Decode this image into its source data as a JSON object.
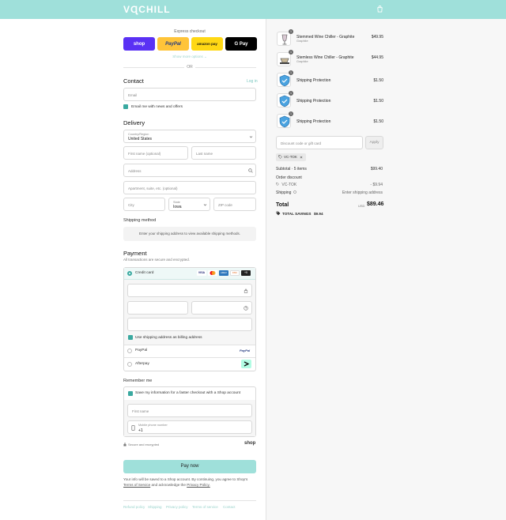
{
  "header": {
    "logo": "VɊCHILL"
  },
  "express": {
    "title": "Express checkout",
    "buttons": [
      "shop",
      "PayPal",
      "amazon pay",
      "G Pay"
    ],
    "show_more": "Show more options ⌄",
    "or": "OR"
  },
  "contact": {
    "heading": "Contact",
    "login": "Log in",
    "email_placeholder": "Email",
    "news_label": "Email me with news and offers"
  },
  "delivery": {
    "heading": "Delivery",
    "country_label": "Country/Region",
    "country_value": "United States",
    "first_name": "First name (optional)",
    "last_name": "Last name",
    "address": "Address",
    "apartment": "Apartment, suite, etc. (optional)",
    "city": "City",
    "state_label": "State",
    "state_value": "Iowa",
    "zip": "ZIP code"
  },
  "shipping": {
    "heading": "Shipping method",
    "message": "Enter your shipping address to view available shipping methods."
  },
  "payment": {
    "heading": "Payment",
    "subheading": "All transactions are secure and encrypted.",
    "credit_card_label": "Credit card",
    "card_logos": [
      "VISA",
      "MC",
      "AMEX",
      "DISC",
      "+5"
    ],
    "billing_label": "Use shipping address as billing address",
    "paypal_label": "PayPal",
    "paypal_logo": "PayPal",
    "afterpay_label": "Afterpay"
  },
  "remember": {
    "heading": "Remember me",
    "save_label": "Save my information for a faster checkout with a Shop account",
    "first_name": "First name",
    "phone_label": "Mobile phone number",
    "phone_value": "+1",
    "secure": "Secure and encrypted",
    "shop_logo": "shop"
  },
  "pay_now": "Pay now",
  "legal": {
    "text": "Your info will be saved to a Shop account. By continuing, you agree to Shop’s",
    "tos": "Terms of Service",
    "and": "and acknowledge the",
    "privacy": "Privacy Policy."
  },
  "footer": [
    "Refund policy",
    "Shipping",
    "Privacy policy",
    "Terms of service",
    "Contact"
  ],
  "order": {
    "items": [
      {
        "name": "Stemmed Wine Chiller - Graphite",
        "variant": "Graphite",
        "qty": "1",
        "price": "$49.95"
      },
      {
        "name": "Stemless Wine Chiller - Graphite",
        "variant": "Graphite",
        "qty": "1",
        "price": "$44.95"
      },
      {
        "name": "Shipping Protection",
        "variant": "",
        "qty": "1",
        "price": "$1.50"
      },
      {
        "name": "Shipping Protection",
        "variant": "",
        "qty": "1",
        "price": "$1.50"
      },
      {
        "name": "Shipping Protection",
        "variant": "",
        "qty": "1",
        "price": "$1.50"
      }
    ],
    "discount_placeholder": "Discount code or gift card",
    "apply": "Apply",
    "code_tag": "VC-TOK",
    "subtotal_label": "Subtotal · 5 items",
    "subtotal_value": "$99.40",
    "order_discount_label": "Order discount",
    "discount_code": "VC-TOK",
    "discount_value": "- $9.94",
    "shipping_label": "Shipping",
    "shipping_value": "Enter shipping address",
    "total_label": "Total",
    "currency": "USD",
    "total_value": "$89.46",
    "savings_label": "TOTAL SAVINGS",
    "savings_value": "$9.94"
  }
}
